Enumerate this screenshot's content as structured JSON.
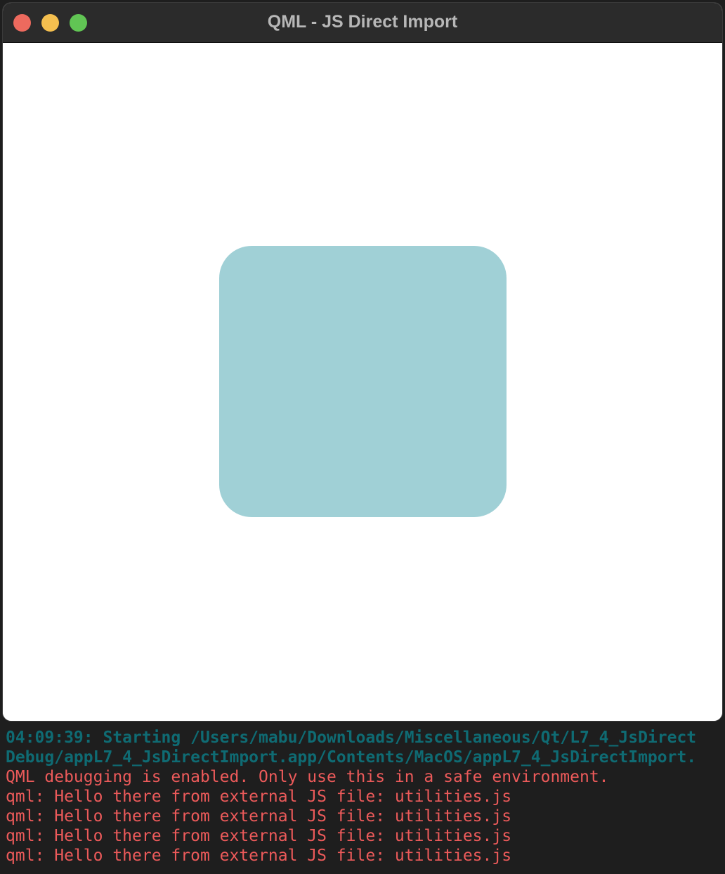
{
  "window": {
    "title": "QML - JS Direct Import",
    "traffic_lights": {
      "close_color": "#ed6a5e",
      "minimize_color": "#f4bf4f",
      "maximize_color": "#61c554"
    }
  },
  "canvas": {
    "background": "#ffffff",
    "shape_color": "#a0d0d6"
  },
  "console": {
    "info_color": "#0f6b73",
    "output_color": "#ec5a5a",
    "lines": [
      "04:09:39: Starting /Users/mabu/Downloads/Miscellaneous/Qt/L7_4_JsDirect",
      "Debug/appL7_4_JsDirectImport.app/Contents/MacOS/appL7_4_JsDirectImport.",
      "QML debugging is enabled. Only use this in a safe environment.",
      "qml: Hello there from external JS file: utilities.js",
      "qml: Hello there from external JS file: utilities.js",
      "qml: Hello there from external JS file: utilities.js",
      "qml: Hello there from external JS file: utilities.js"
    ]
  }
}
